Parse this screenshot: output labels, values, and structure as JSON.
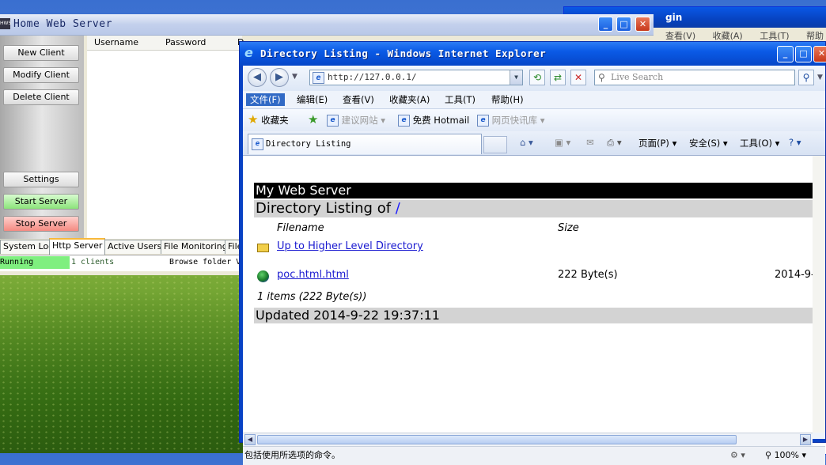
{
  "background_window": {
    "title_fragment": "gin",
    "menu": [
      "查看(V)",
      "收藏(A)",
      "工具(T)",
      "帮助(H)"
    ]
  },
  "home_web_server": {
    "title": "Home Web Server",
    "logo_text": "HWS",
    "buttons": {
      "new_client": "New Client",
      "modify_client": "Modify Client",
      "delete_client": "Delete Client",
      "settings": "Settings",
      "start_server": "Start Server",
      "stop_server": "Stop Server"
    },
    "list_headers": [
      "Username",
      "Password",
      "D"
    ],
    "tabs": [
      "System Log",
      "Http Server",
      "Active Users",
      "File Monitoring",
      "File"
    ],
    "status": {
      "state": "Running",
      "clients": "1 clients",
      "hint": "Browse folder V"
    }
  },
  "ie": {
    "title": "Directory Listing - Windows Internet Explorer",
    "address": "http://127.0.0.1/",
    "search_placeholder": "Live Search",
    "menu": [
      "文件(F)",
      "编辑(E)",
      "查看(V)",
      "收藏夹(A)",
      "工具(T)",
      "帮助(H)"
    ],
    "favorites": {
      "label": "收藏夹",
      "items": [
        "建议网站",
        "免费 Hotmail",
        "网页快讯库"
      ]
    },
    "tab_title": "Directory Listing",
    "commands": [
      "页面(P)",
      "安全(S)",
      "工具(O)"
    ],
    "status_text": "包括使用所选项的命令。",
    "zoom": "100%"
  },
  "page": {
    "site_title": "My Web Server",
    "listing_prefix": "Directory Listing of",
    "listing_path": "/",
    "columns": {
      "filename": "Filename",
      "size": "Size"
    },
    "up_link": "Up to Higher Level Directory",
    "files": [
      {
        "name": "poc.html.html",
        "size": "222 Byte(s)",
        "date": "2014-9-"
      }
    ],
    "summary": "1 items (222 Byte(s))",
    "updated": "Updated 2014-9-22 19:37:11"
  }
}
